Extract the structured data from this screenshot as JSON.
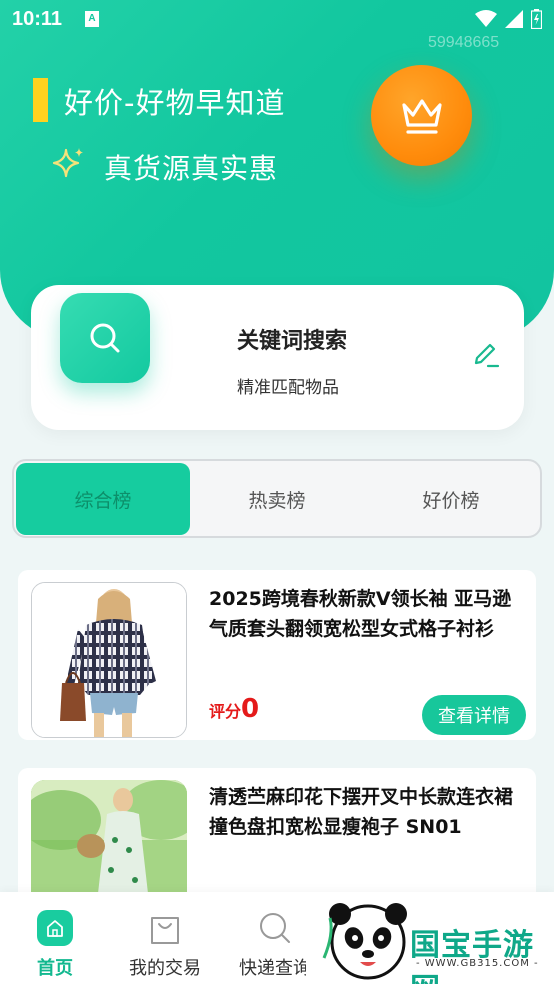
{
  "status_bar": {
    "time": "10:11",
    "a_badge": "A"
  },
  "header": {
    "user_id": "59948665",
    "title": "好价-好物早知道",
    "subtitle": "真货源真实惠"
  },
  "search_card": {
    "title": "关键词搜索",
    "subtitle": "精准匹配物品"
  },
  "tabs": [
    {
      "label": "综合榜",
      "active": true
    },
    {
      "label": "热卖榜",
      "active": false
    },
    {
      "label": "好价榜",
      "active": false
    }
  ],
  "products": [
    {
      "title": "2025跨境春秋新款V领长袖 亚马逊气质套头翻领宽松型女式格子衬衫",
      "rating_label": "评分",
      "rating_value": "0",
      "detail_label": "查看详情"
    },
    {
      "title": "清透苎麻印花下摆开叉中长款连衣裙撞色盘扣宽松显瘦袍子 SN01"
    }
  ],
  "bottom_nav": [
    {
      "label": "首页",
      "icon": "home-icon",
      "active": true
    },
    {
      "label": "我的交易",
      "icon": "bag-icon",
      "active": false
    },
    {
      "label": "快递查询",
      "icon": "search-icon",
      "active": false
    }
  ],
  "watermark": {
    "text": "国宝手游网",
    "url": "- WWW.GB315.COM -"
  },
  "colors": {
    "primary": "#16cc9f",
    "accent_orange": "#ff8c0c",
    "accent_yellow": "#ffd21f",
    "rating_red": "#e41a1a"
  }
}
